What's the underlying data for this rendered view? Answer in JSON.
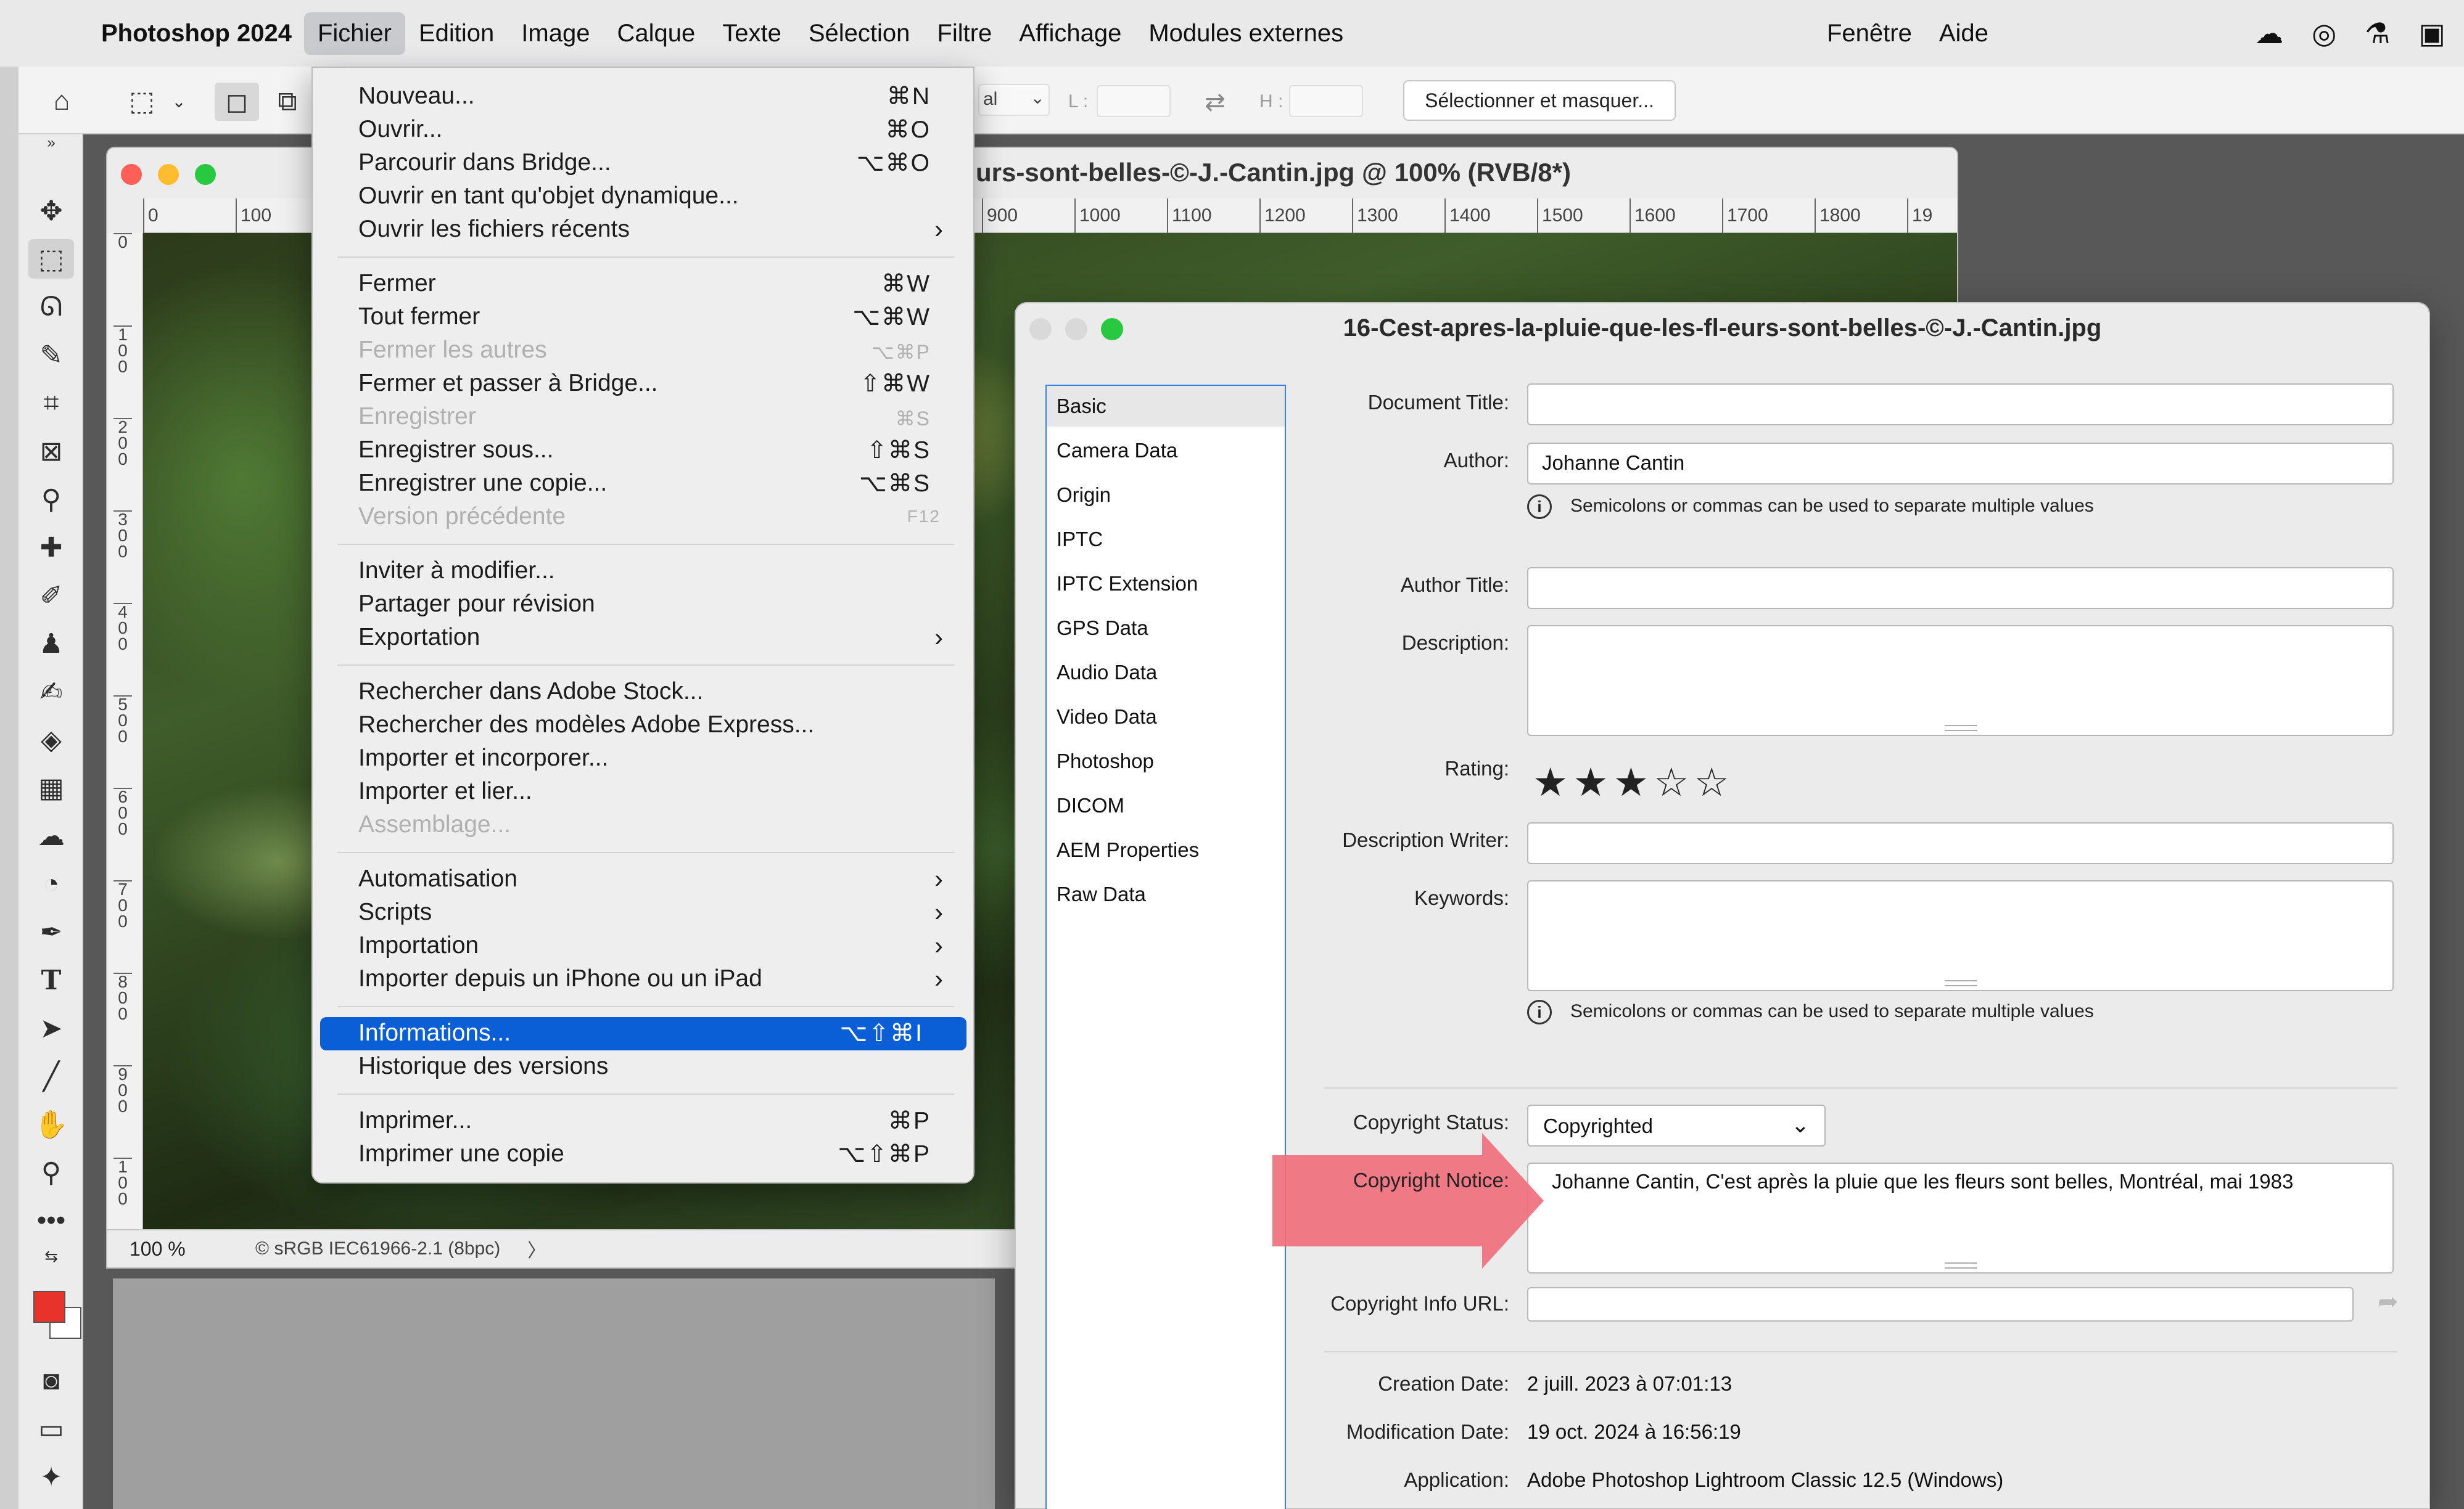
{
  "menubar": {
    "app_name": "Photoshop 2024",
    "menus": [
      "Fichier",
      "Edition",
      "Image",
      "Calque",
      "Texte",
      "Sélection",
      "Filtre",
      "Affichage",
      "Modules externes"
    ],
    "right_menus": [
      "Fenêtre",
      "Aide"
    ]
  },
  "optionsbar": {
    "style_value": "al",
    "width_label": "L :",
    "height_label": "H :",
    "select_mask_label": "Sélectionner et masquer..."
  },
  "document": {
    "title": "urs-sont-belles-©-J.-Cantin.jpg @ 100% (RVB/8*)",
    "ruler_h": [
      "0",
      "100",
      "900",
      "1000",
      "1100",
      "1200",
      "1300",
      "1400",
      "1500",
      "1600",
      "1700",
      "1800",
      "19"
    ],
    "ruler_v": [
      "0",
      "1\n0\n0",
      "2\n0\n0",
      "3\n0\n0",
      "4\n0\n0",
      "5\n0\n0",
      "6\n0\n0",
      "7\n0\n0",
      "8\n0\n0",
      "9\n0\n0",
      "1\n0\n0"
    ],
    "zoom": "100 %",
    "profile": "© sRGB IEC61966-2.1 (8bpc)",
    "status_arrow": "〉"
  },
  "filemenu": {
    "items": [
      {
        "label": "Nouveau...",
        "shortcut": "⌘N"
      },
      {
        "label": "Ouvrir...",
        "shortcut": "⌘O"
      },
      {
        "label": "Parcourir dans Bridge...",
        "shortcut": "⌥⌘O"
      },
      {
        "label": "Ouvrir en tant qu'objet dynamique...",
        "shortcut": ""
      },
      {
        "label": "Ouvrir les fichiers récents",
        "shortcut": "",
        "submenu": true
      },
      {
        "label": "Fermer",
        "shortcut": "⌘W"
      },
      {
        "label": "Tout fermer",
        "shortcut": "⌥⌘W"
      },
      {
        "label": "Fermer les autres",
        "shortcut": "⌥⌘P",
        "disabled": true
      },
      {
        "label": "Fermer et passer à Bridge...",
        "shortcut": "⇧⌘W"
      },
      {
        "label": "Enregistrer",
        "shortcut": "⌘S",
        "disabled": true
      },
      {
        "label": "Enregistrer sous...",
        "shortcut": "⇧⌘S"
      },
      {
        "label": "Enregistrer une copie...",
        "shortcut": "⌥⌘S"
      },
      {
        "label": "Version précédente",
        "shortcut": "F12",
        "disabled": true
      },
      {
        "label": "Inviter à modifier...",
        "shortcut": ""
      },
      {
        "label": "Partager pour révision",
        "shortcut": ""
      },
      {
        "label": "Exportation",
        "shortcut": "",
        "submenu": true
      },
      {
        "label": "Rechercher dans Adobe Stock...",
        "shortcut": ""
      },
      {
        "label": "Rechercher des modèles Adobe Express...",
        "shortcut": ""
      },
      {
        "label": "Importer et incorporer...",
        "shortcut": ""
      },
      {
        "label": "Importer et lier...",
        "shortcut": ""
      },
      {
        "label": "Assemblage...",
        "shortcut": "",
        "disabled": true
      },
      {
        "label": "Automatisation",
        "shortcut": "",
        "submenu": true
      },
      {
        "label": "Scripts",
        "shortcut": "",
        "submenu": true
      },
      {
        "label": "Importation",
        "shortcut": "",
        "submenu": true
      },
      {
        "label": "Importer depuis un iPhone ou un iPad",
        "shortcut": "",
        "submenu": true
      },
      {
        "label": "Informations...",
        "shortcut": "⌥⇧⌘I",
        "highlight": true
      },
      {
        "label": "Historique des versions",
        "shortcut": ""
      },
      {
        "label": "Imprimer...",
        "shortcut": "⌘P"
      },
      {
        "label": "Imprimer une copie",
        "shortcut": "⌥⇧⌘P"
      }
    ]
  },
  "infodialog": {
    "title": "16-Cest-apres-la-pluie-que-les-fl-eurs-sont-belles-©-J.-Cantin.jpg",
    "sidebar": [
      "Basic",
      "Camera Data",
      "Origin",
      "IPTC",
      "IPTC Extension",
      "GPS Data",
      "Audio Data",
      "Video Data",
      "Photoshop",
      "DICOM",
      "AEM Properties",
      "Raw Data"
    ],
    "selected_tab": "Basic",
    "fields": {
      "document_title_label": "Document Title:",
      "document_title_value": "",
      "author_label": "Author:",
      "author_value": "Johanne Cantin",
      "author_hint": "Semicolons or commas can be used to separate multiple values",
      "author_title_label": "Author Title:",
      "author_title_value": "",
      "description_label": "Description:",
      "description_value": "",
      "rating_label": "Rating:",
      "rating_value": 3,
      "rating_max": 5,
      "description_writer_label": "Description Writer:",
      "description_writer_value": "",
      "keywords_label": "Keywords:",
      "keywords_value": "",
      "keywords_hint": "Semicolons or commas can be used to separate multiple values",
      "copyright_status_label": "Copyright Status:",
      "copyright_status_value": "Copyrighted",
      "copyright_notice_label": "Copyright Notice:",
      "copyright_notice_value": "Johanne Cantin, C'est après la pluie que les fleurs sont belles, Montréal, mai 1983",
      "copyright_url_label": "Copyright Info URL:",
      "copyright_url_value": "",
      "creation_date_label": "Creation Date:",
      "creation_date_value": "2 juill. 2023 à 07:01:13",
      "modification_date_label": "Modification Date:",
      "modification_date_value": "19 oct. 2024 à 16:56:19",
      "application_label": "Application:",
      "application_value": "Adobe Photoshop Lightroom Classic 12.5 (Windows)"
    }
  },
  "colors": {
    "menu_highlight": "#0a5fd6",
    "annotation_arrow": "#ef6f7c",
    "foreground_swatch": "#e8322c",
    "traffic_red": "#fe5f57",
    "traffic_yellow": "#febc2e",
    "traffic_green": "#28c840"
  }
}
